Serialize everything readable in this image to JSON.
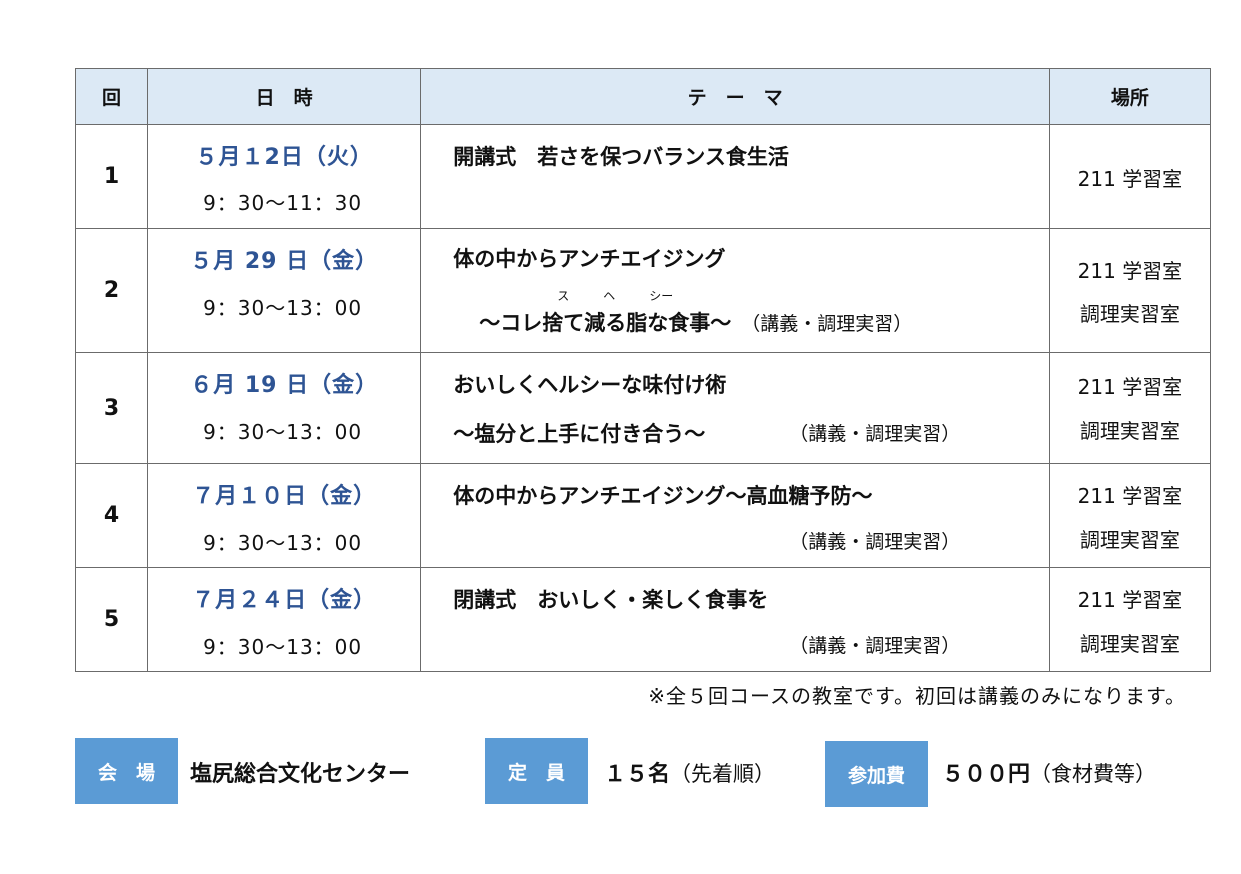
{
  "table": {
    "headers": {
      "num": "回",
      "date": "日　時",
      "theme": "テ　ー　マ",
      "place": "場所"
    },
    "rows": [
      {
        "num": "1",
        "date": "５月１2日（火）",
        "time": "9：30～11：30",
        "theme_line1": "開講式　若さを保つバランス食生活",
        "place1": "211 学習室"
      },
      {
        "num": "2",
        "date": "５月 29 日（金）",
        "time": "9：30～13：00",
        "theme_line1": "体の中からアンチエイジング",
        "theme_line2": "～コレ捨て減る脂な食事～",
        "note": "（講義・調理実習）",
        "ruby1": "ス",
        "ruby2": "ヘ",
        "ruby3": "シー",
        "place1": "211 学習室",
        "place2": "調理実習室"
      },
      {
        "num": "3",
        "date": "６月 19 日（金）",
        "time": "9：30～13：00",
        "theme_line1": "おいしくヘルシーな味付け術",
        "theme_line2": "～塩分と上手に付き合う～",
        "note": "（講義・調理実習）",
        "place1": "211 学習室",
        "place2": "調理実習室"
      },
      {
        "num": "4",
        "date": "７月１０日（金）",
        "time": "9：30～13：00",
        "theme_line1": "体の中からアンチエイジング～高血糖予防～",
        "note": "（講義・調理実習）",
        "place1": "211 学習室",
        "place2": "調理実習室"
      },
      {
        "num": "5",
        "date": "７月２４日（金）",
        "time": "9：30～13：00",
        "theme_line1": "閉講式　おいしく・楽しく食事を",
        "note": "（講義・調理実習）",
        "place1": "211 学習室",
        "place2": "調理実習室"
      }
    ]
  },
  "footnote": "※全５回コースの教室です。初回は講義のみになります。",
  "info": {
    "venue_label": "会　場",
    "venue_value": "塩尻総合文化センター",
    "capacity_label": "定　員",
    "capacity_value": "１５名",
    "capacity_note": "（先着順）",
    "fee_label": "参加費",
    "fee_value": "５００円",
    "fee_note": "（食材費等）"
  },
  "colors": {
    "header_bg": "#dce9f5",
    "date_text": "#2e5494",
    "label_bg": "#5b9bd5"
  }
}
